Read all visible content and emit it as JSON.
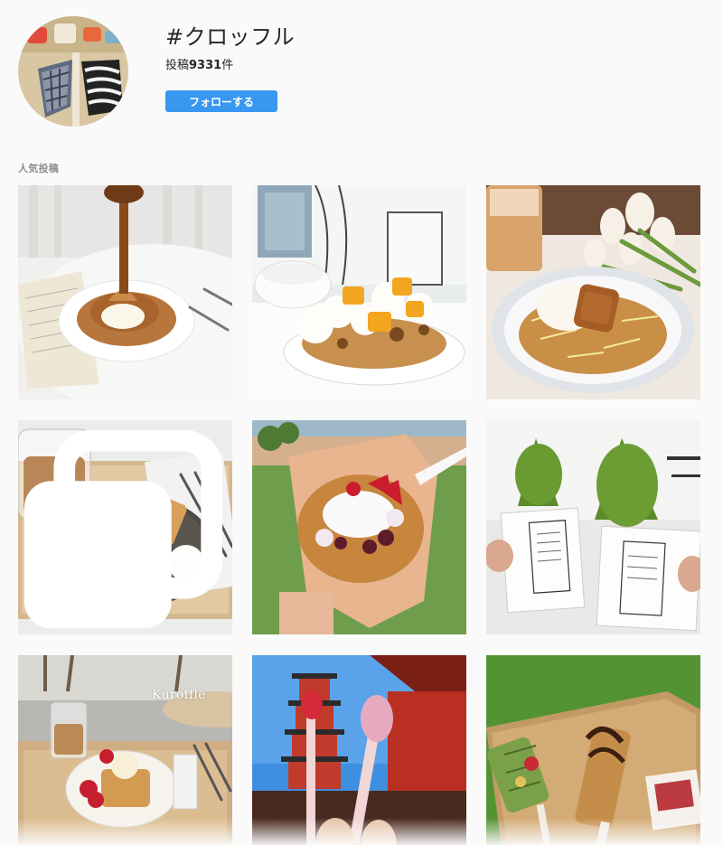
{
  "hashtag": {
    "title": "#クロッフル",
    "count_prefix": "投稿",
    "count_value": "9331",
    "count_suffix": "件",
    "follow_label": "フォローする"
  },
  "section": {
    "label": "人気投稿"
  },
  "posts": [
    {
      "photo": "croffle-caramel-pour-plate",
      "multi": false
    },
    {
      "photo": "croffle-whipped-cream-mango",
      "multi": false
    },
    {
      "photo": "croffle-lotus-biscoff-tulips",
      "multi": false
    },
    {
      "photo": "croffle-icecream-strawberry-tray",
      "multi": true
    },
    {
      "photo": "croffle-cone-strawberry-park",
      "multi": false
    },
    {
      "photo": "matcha-croffle-cones-menu",
      "multi": false
    },
    {
      "photo": "croffle-cafe-latte-table",
      "multi": false,
      "overlay_text": "Kuroffle"
    },
    {
      "photo": "croffle-sticks-pagoda-sky",
      "multi": false
    },
    {
      "photo": "croffle-sticks-wood-board",
      "multi": false
    }
  ],
  "colors": {
    "accent": "#3897f0",
    "background": "#fafafa",
    "muted_text": "#8e8e8e"
  }
}
